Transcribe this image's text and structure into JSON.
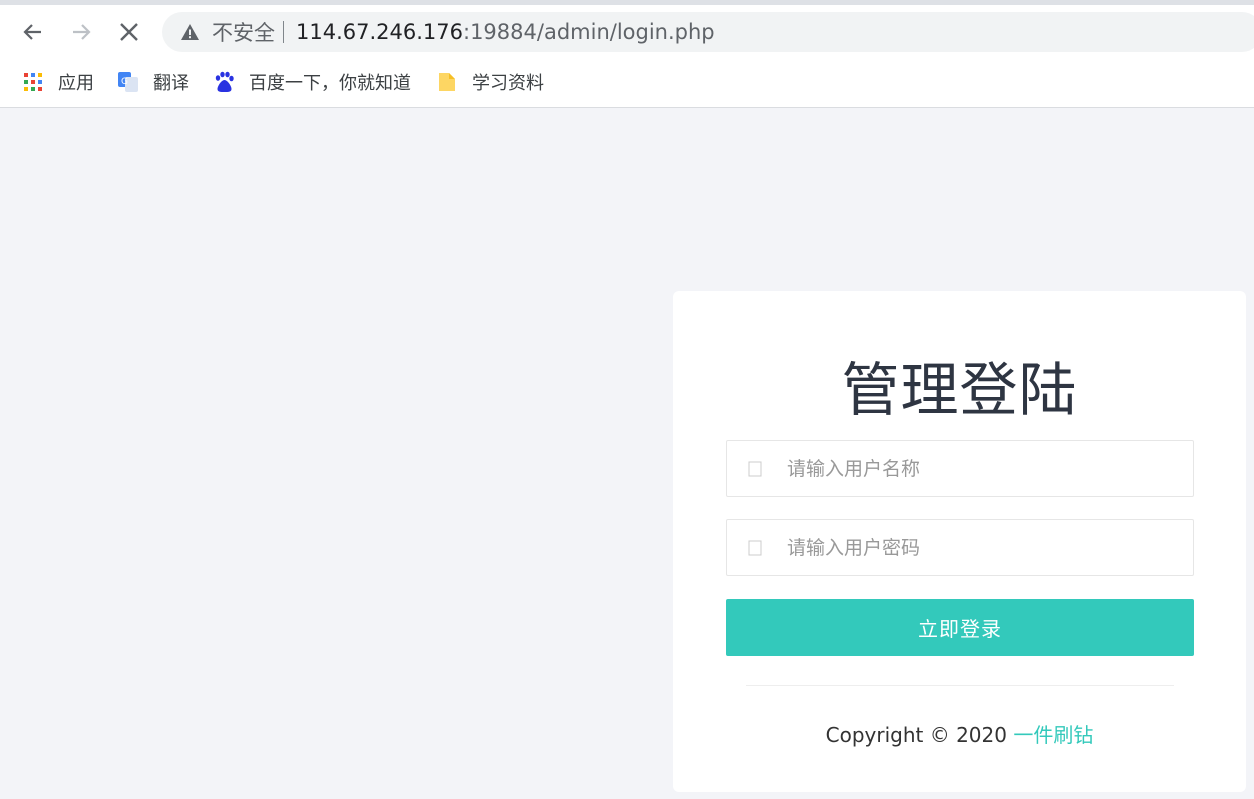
{
  "browser": {
    "not_secure_label": "不安全",
    "url_host": "114.67.246.176",
    "url_rest": ":19884/admin/login.php"
  },
  "bookmarks": [
    {
      "label": "应用",
      "icon": "apps-grid-icon"
    },
    {
      "label": "翻译",
      "icon": "google-translate-icon"
    },
    {
      "label": "百度一下，你就知道",
      "icon": "baidu-paw-icon"
    },
    {
      "label": "学习资料",
      "icon": "folder-icon"
    }
  ],
  "login": {
    "title": "管理登陆",
    "username_placeholder": "请输入用户名称",
    "password_placeholder": "请输入用户密码",
    "submit_label": "立即登录",
    "copyright_text": "Copyright © 2020 ",
    "copyright_link": "一件刷钻"
  },
  "colors": {
    "accent": "#33c9bb",
    "page_bg": "#f3f4f8",
    "title": "#2e3542"
  }
}
